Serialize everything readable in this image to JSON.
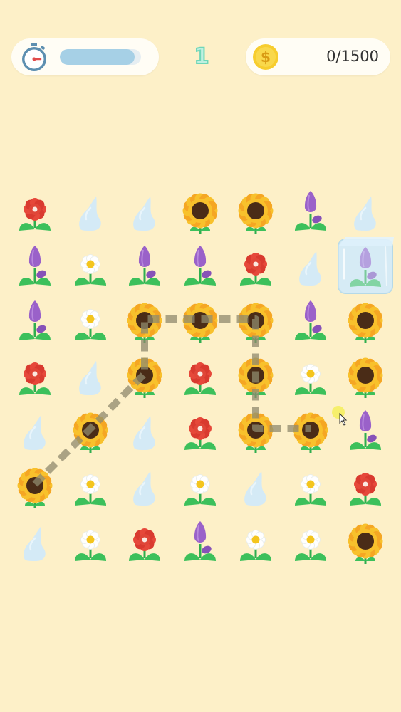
{
  "hud": {
    "level": "1",
    "timer_progress": 0.92,
    "coins": "0/1500",
    "coin_symbol": "$"
  },
  "colors": {
    "background": "#fdf0c8",
    "timer_fill": "#a6d0e6",
    "path": "#8f8a6e"
  },
  "board": {
    "rows": [
      [
        "red-flower",
        "water-drop",
        "water-drop",
        "sunflower",
        "sunflower",
        "tulip",
        "water-drop"
      ],
      [
        "tulip",
        "daisy",
        "tulip",
        "tulip",
        "red-flower",
        "water-drop",
        "frozen-tulip"
      ],
      [
        "tulip",
        "daisy",
        "sunflower",
        "sunflower",
        "sunflower",
        "tulip",
        "sunflower"
      ],
      [
        "red-flower",
        "water-drop",
        "sunflower",
        "red-flower",
        "sunflower",
        "daisy",
        "sunflower"
      ],
      [
        "water-drop",
        "sunflower",
        "water-drop",
        "red-flower",
        "sunflower",
        "sunflower",
        "tulip"
      ],
      [
        "sunflower",
        "daisy",
        "water-drop",
        "daisy",
        "water-drop",
        "daisy",
        "red-flower"
      ],
      [
        "water-drop",
        "daisy",
        "red-flower",
        "tulip",
        "daisy",
        "daisy",
        "sunflower"
      ]
    ],
    "connection_path": [
      [
        5,
        0
      ],
      [
        4,
        1
      ],
      [
        3,
        2
      ],
      [
        2,
        2
      ],
      [
        2,
        3
      ],
      [
        2,
        4
      ],
      [
        3,
        4
      ],
      [
        4,
        4
      ],
      [
        4,
        5
      ]
    ]
  }
}
